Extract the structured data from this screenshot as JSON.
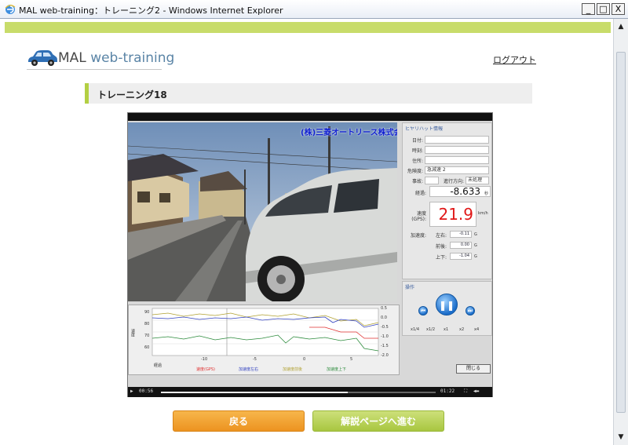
{
  "window": {
    "title": "MAL web-training：トレーニング2 - Windows Internet Explorer",
    "minimize": "_",
    "maximize": "□",
    "close": "X"
  },
  "header": {
    "logo_main": "MAL",
    "logo_sub": "web-training",
    "logout": "ログアウト"
  },
  "section": {
    "title": "トレーニング18"
  },
  "player": {
    "overlay_text": "(株)三菱オートリース株式会社",
    "info": {
      "heading": "ヒヤリハット情報",
      "date_label": "日付:",
      "time_label": "時刻:",
      "address_label": "住所:",
      "risk_label": "危険度:",
      "risk_value": "急減速 2",
      "case_label": "事故:",
      "direction_label": "進行方向:",
      "direction_value": "未処理",
      "elapsed_label": "経過:",
      "elapsed_value": "-8.633",
      "elapsed_unit": "秒",
      "speed_label": "速度(GPS):",
      "speed_value": "21.9",
      "speed_unit": "km/h",
      "accel_label": "加速度:",
      "accel_lr_label": "左右:",
      "accel_lr_value": "-0.11",
      "accel_fb_label": "前後:",
      "accel_fb_value": "0.00",
      "accel_ud_label": "上下:",
      "accel_ud_value": "-1.04",
      "g_unit": "G"
    },
    "controls": {
      "heading": "操作",
      "prev_icon": "prev-icon",
      "pause_icon": "pause-icon",
      "next_icon": "next-icon",
      "speeds": [
        "x1/4",
        "x1/2",
        "x1",
        "x2",
        "x4"
      ],
      "selected_speed": "x1",
      "close_label": "閉じる"
    },
    "graph": {
      "y_left_label": "速度",
      "y_left_ticks": [
        "90",
        "80",
        "70",
        "60"
      ],
      "y_right_ticks": [
        "0.5",
        "0.0",
        "-0.5",
        "-1.0",
        "-1.5",
        "-2.0"
      ],
      "x_ticks": [
        "-10",
        "-5",
        "0",
        "5"
      ],
      "x_label": "経過",
      "legend": [
        {
          "label": "速度(GPS)",
          "color": "#e03030"
        },
        {
          "label": "加速度左右",
          "color": "#3040c0"
        },
        {
          "label": "加速度前後",
          "color": "#b0a030"
        },
        {
          "label": "加速度上下",
          "color": "#2a8a3a"
        }
      ]
    },
    "seek": {
      "current": "00:56",
      "total": "01:22",
      "progress": 0.68
    }
  },
  "buttons": {
    "back": "戻る",
    "next": "解説ページへ進む"
  }
}
